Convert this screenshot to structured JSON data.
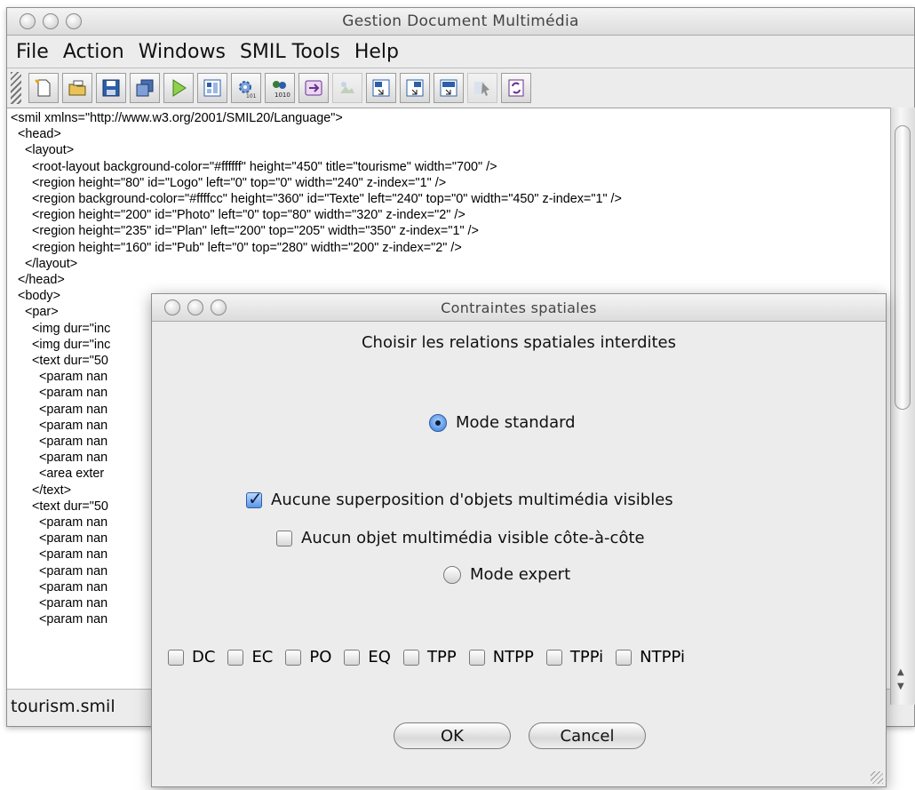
{
  "window": {
    "title": "Gestion Document Multimédia"
  },
  "menu": [
    "File",
    "Action",
    "Windows",
    "SMIL Tools",
    "Help"
  ],
  "toolbar_icons": [
    "new-document-icon",
    "open-folder-icon",
    "save-icon",
    "copy-icon",
    "play-icon",
    "layout-icon",
    "settings-icon",
    "binary-convert-icon",
    "export-icon",
    "import-icon",
    "region-icon",
    "region-move-icon",
    "region-resize-icon",
    "pointer-icon",
    "refresh-icon"
  ],
  "code_lines": [
    "<smil xmlns=\"http://www.w3.org/2001/SMIL20/Language\">",
    "  <head>",
    "    <layout>",
    "      <root-layout background-color=\"#ffffff\" height=\"450\" title=\"tourisme\" width=\"700\" />",
    "      <region height=\"80\" id=\"Logo\" left=\"0\" top=\"0\" width=\"240\" z-index=\"1\" />",
    "      <region background-color=\"#ffffcc\" height=\"360\" id=\"Texte\" left=\"240\" top=\"0\" width=\"450\" z-index=\"1\" />",
    "      <region height=\"200\" id=\"Photo\" left=\"0\" top=\"80\" width=\"320\" z-index=\"2\" />",
    "      <region height=\"235\" id=\"Plan\" left=\"200\" top=\"205\" width=\"350\" z-index=\"1\" />",
    "      <region height=\"160\" id=\"Pub\" left=\"0\" top=\"280\" width=\"200\" z-index=\"2\" />",
    "    </layout>",
    "  </head>",
    "  <body>",
    "    <par>",
    "      <img dur=\"inc",
    "      <img dur=\"inc",
    "      <text dur=\"50",
    "        <param nan",
    "        <param nan",
    "        <param nan",
    "        <param nan",
    "        <param nan",
    "        <param nan",
    "        <area exter",
    "      </text>",
    "      <text dur=\"50",
    "        <param nan",
    "        <param nan",
    "        <param nan",
    "        <param nan",
    "        <param nan",
    "        <param nan",
    "        <param nan"
  ],
  "status": {
    "filename": "tourism.smil"
  },
  "dialog": {
    "title": "Contraintes spatiales",
    "heading": "Choisir les relations spatiales interdites",
    "mode_standard": {
      "label": "Mode standard",
      "selected": true
    },
    "no_overlap": {
      "label": "Aucune superposition d'objets multimédia visibles",
      "checked": true
    },
    "no_side_by_side": {
      "label": "Aucun objet multimédia visible côte-à-côte",
      "checked": false
    },
    "mode_expert": {
      "label": "Mode expert",
      "selected": false
    },
    "relations": [
      "DC",
      "EC",
      "PO",
      "EQ",
      "TPP",
      "NTPP",
      "TPPi",
      "NTPPi"
    ],
    "ok_label": "OK",
    "cancel_label": "Cancel"
  }
}
